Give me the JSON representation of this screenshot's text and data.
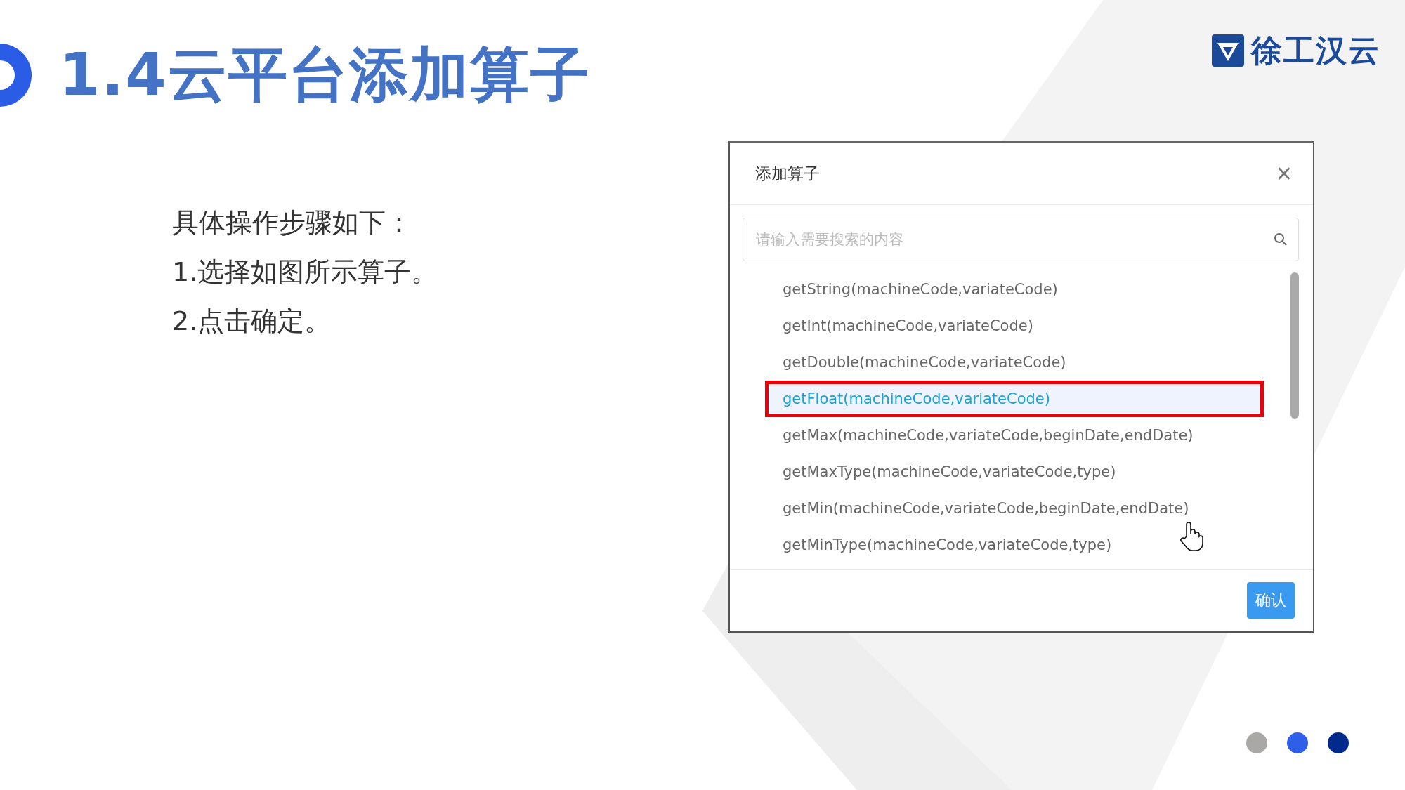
{
  "slide": {
    "title": "1.4云平台添加算子",
    "logo_text": "徐工汉云",
    "steps": [
      "具体操作步骤如下：",
      "1.选择如图所示算子。",
      "2.点击确定。"
    ],
    "pager_dots": [
      {
        "color": "#aaa7a7"
      },
      {
        "color": "#2f5fe8"
      },
      {
        "color": "#002a8c"
      }
    ]
  },
  "dialog": {
    "title": "添加算子",
    "close": "×",
    "search": {
      "placeholder": "请输入需要搜索的内容"
    },
    "items": [
      {
        "label": "getString(machineCode,variateCode)",
        "selected": false
      },
      {
        "label": "getInt(machineCode,variateCode)",
        "selected": false
      },
      {
        "label": "getDouble(machineCode,variateCode)",
        "selected": false
      },
      {
        "label": "getFloat(machineCode,variateCode)",
        "selected": true
      },
      {
        "label": "getMax(machineCode,variateCode,beginDate,endDate)",
        "selected": false
      },
      {
        "label": "getMaxType(machineCode,variateCode,type)",
        "selected": false
      },
      {
        "label": "getMin(machineCode,variateCode,beginDate,endDate)",
        "selected": false
      },
      {
        "label": "getMinType(machineCode,variateCode,type)",
        "selected": false
      }
    ],
    "confirm_button": "确认"
  }
}
